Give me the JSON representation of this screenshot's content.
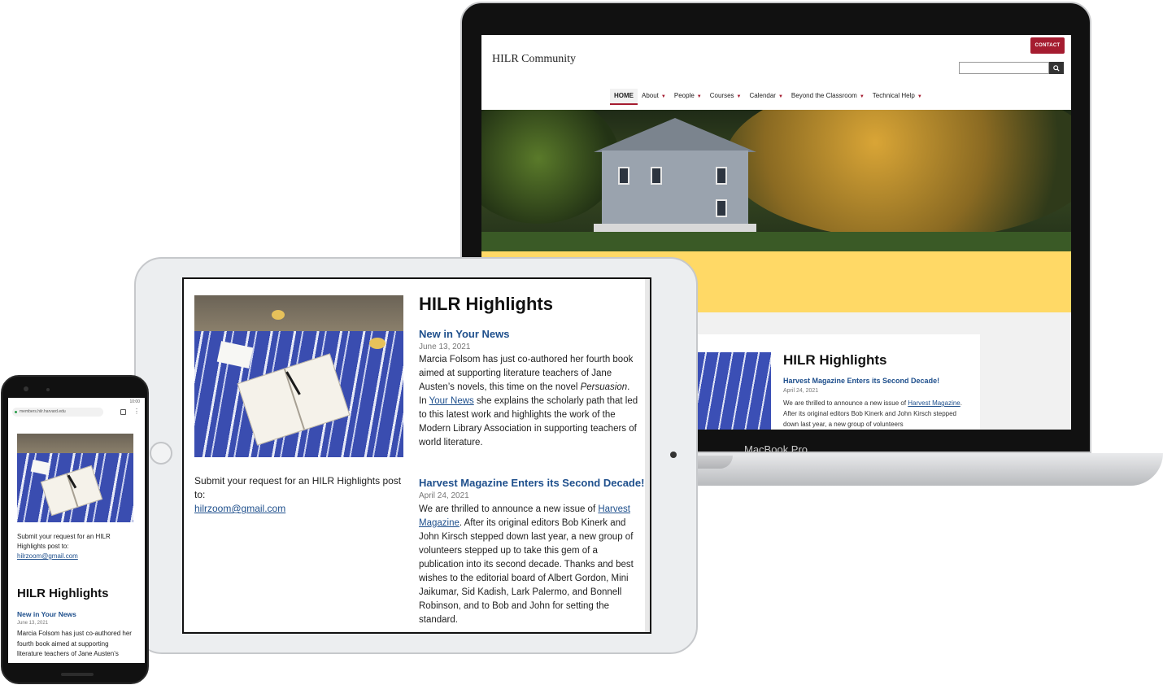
{
  "laptop": {
    "brand_label": "MacBook Pro",
    "site_title": "HILR Community",
    "contact_label": "CONTACT",
    "search_placeholder": "",
    "nav": [
      {
        "label": "HOME",
        "dropdown": false,
        "active": true
      },
      {
        "label": "About",
        "dropdown": true
      },
      {
        "label": "People",
        "dropdown": true
      },
      {
        "label": "Courses",
        "dropdown": true
      },
      {
        "label": "Calendar",
        "dropdown": true
      },
      {
        "label": "Beyond the Classroom",
        "dropdown": true
      },
      {
        "label": "Technical Help",
        "dropdown": true
      }
    ],
    "caret": "▼",
    "card": {
      "heading": "HILR Highlights",
      "news_title": "Harvest Magazine Enters its Second Decade!",
      "date": "April 24, 2021",
      "body_pre": "We are thrilled to announce a new issue of ",
      "body_link": "Harvest Magazine",
      "body_post": ".  After its original editors Bob Kinerk and John Kirsch stepped down last year, a new group of volunteers"
    },
    "accent_color": "#a51c30",
    "band_color": "#ffd966"
  },
  "tablet": {
    "submit_text": "Submit your request for an HILR Highlights post to:",
    "email": "hilrzoom@gmail.com",
    "heading": "HILR Highlights",
    "news1": {
      "title": "New in Your News",
      "date": "June 13, 2021",
      "body_pre": "Marcia Folsom has just co-authored her fourth book aimed at supporting literature teachers of Jane Austen’s novels, this time on the novel ",
      "body_italic": "Persuasion",
      "body_mid": ". In ",
      "body_link": "Your News",
      "body_post": " she explains the scholarly path that led to this latest work and highlights the work of the Modern Library Association in supporting teachers of world literature."
    },
    "news2": {
      "title": "Harvest Magazine Enters its Second Decade!",
      "date": "April 24, 2021",
      "body_pre": "We are thrilled to announce a new issue of ",
      "body_link": "Harvest Magazine",
      "body_post": ".  After its original editors Bob Kinerk and John Kirsch stepped down last year, a new group of volunteers stepped up to take this gem of a publication into its second decade. Thanks and best wishes to the editorial board of Albert Gordon, Mini Jaikumar, Sid Kadish, Lark Palermo, and Bonnell Robinson, and to Bob and John for setting the standard."
    },
    "link_color": "#1e4f8c"
  },
  "phone": {
    "status_time": "10:00",
    "url": "members.hilr.harvard.edu",
    "menu_glyph": "⋮",
    "submit_text": "Submit your request for an HILR Highlights post to:",
    "email": "hilrzoom@gmail.com",
    "heading": "HILR Highlights",
    "news_title": "New in Your News",
    "date": "June 13, 2021",
    "body": "Marcia Folsom has just co-authored her fourth book aimed at supporting literature teachers of Jane Austen’s"
  }
}
